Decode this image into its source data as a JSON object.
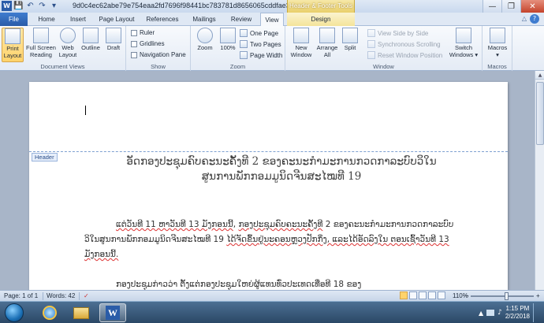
{
  "window": {
    "title": "9d0c4ec62abe79e754eaa2fd7696f98441bc783781d8656065cddfae3dbf503e ...",
    "context_tools_label": "Header & Footer Tools"
  },
  "qat": {
    "save": "💾",
    "undo": "↶",
    "redo": "↷",
    "customize": "▾"
  },
  "winctrl": {
    "minimize": "—",
    "maximize": "❐",
    "close": "✕"
  },
  "tabs": [
    {
      "label": "File",
      "active": false
    },
    {
      "label": "Home",
      "active": false
    },
    {
      "label": "Insert",
      "active": false
    },
    {
      "label": "Page Layout",
      "active": false
    },
    {
      "label": "References",
      "active": false
    },
    {
      "label": "Mailings",
      "active": false
    },
    {
      "label": "Review",
      "active": false
    },
    {
      "label": "View",
      "active": true
    },
    {
      "label": "Design",
      "active": false
    }
  ],
  "ribbon_minimize": "△",
  "help": "?",
  "ribbon": {
    "document_views": {
      "label": "Document Views",
      "buttons": [
        "Print Layout",
        "Full Screen Reading",
        "Web Layout",
        "Outline",
        "Draft"
      ]
    },
    "show": {
      "label": "Show",
      "items": [
        {
          "label": "Ruler",
          "checked": false
        },
        {
          "label": "Gridlines",
          "checked": false
        },
        {
          "label": "Navigation Pane",
          "checked": false
        }
      ]
    },
    "zoom": {
      "label": "Zoom",
      "zoom_btn": "Zoom",
      "percent_btn": "100%",
      "one_page": "One Page",
      "two_pages": "Two Pages",
      "page_width": "Page Width"
    },
    "window": {
      "label": "Window",
      "new_window": "New Window",
      "arrange_all": "Arrange All",
      "split": "Split",
      "view_side": "View Side by Side",
      "sync_scroll": "Synchronous Scrolling",
      "reset_pos": "Reset Window Position",
      "switch_windows": "Switch Windows ▾"
    },
    "macros": {
      "label": "Macros",
      "button": "Macros ▾"
    }
  },
  "document": {
    "header_tag": "Header",
    "heading_line1": "ອັດກອງປະຊຸມຄົບຄະນະຄັ້ງທີ 2 ຂອງຄະນະກຳມະການກວດກາລະບົບວິໃນ",
    "heading_line2": "ສູນການພັກກອມມູນິດຈີນສະໄໝທີ 19",
    "para1_red1": "ແຕ່ວັນທີ 11 ຫາວັນທີ 13 ມັງກອນນີ້",
    "para1_mid": ", ",
    "para1_red2": "ກອງປະຊຸມຄົບຄະນະຄັ້ງທີ",
    "para1_rest": " 2 ຂອງຄະນະກຳມະການກວດກາລະບົບວິໃນສູນການພັກກອມມູນິດຈີນສະໄໝທີ 19 ",
    "para1_red3": "ໄດ້ຈັດຂຶ້ນຢູ່ນະຄອນຫຼວງປັກກິ່ງ, ແລະໄດ້ອັດລົງໃນ ຕອນເຊົ້າວັນທີ 13 ມັງກອນນີ້.",
    "para2": "ກອງປະຊຸມກ່າວວ່າ ຕັ້ງແຕ່ກອງປະຊຸມໃຫຍ່ຜູ້ແທນທົ່ວປະເທດເທື່ອທີ 18 ຂອງ"
  },
  "status": {
    "page": "Page: 1 of 1",
    "words": "Words: 42",
    "zoom": "110%",
    "zoom_minus": "−",
    "zoom_plus": "+"
  },
  "taskbar": {
    "time": "1:15 PM",
    "date": "2/2/2018",
    "word_icon": "W"
  }
}
